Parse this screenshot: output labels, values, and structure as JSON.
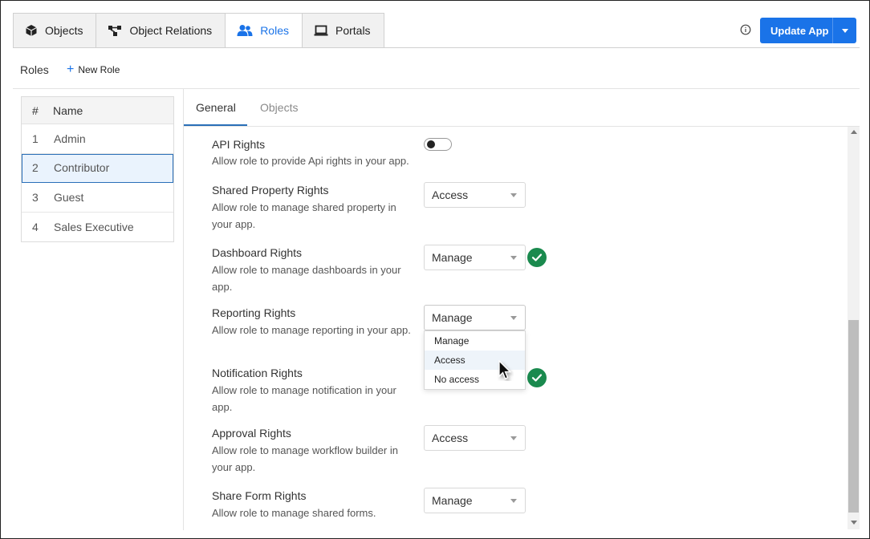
{
  "top_tabs": [
    {
      "label": "Objects",
      "icon": "cube-icon"
    },
    {
      "label": "Object Relations",
      "icon": "relations-icon"
    },
    {
      "label": "Roles",
      "icon": "users-icon",
      "active": true
    },
    {
      "label": "Portals",
      "icon": "laptop-icon"
    }
  ],
  "header": {
    "update_label": "Update App",
    "accent_color": "#1a73e8"
  },
  "subheader": {
    "title": "Roles",
    "new_role_label": "New Role"
  },
  "roles_table": {
    "col_num": "#",
    "col_name": "Name",
    "rows": [
      {
        "num": "1",
        "name": "Admin"
      },
      {
        "num": "2",
        "name": "Contributor",
        "selected": true
      },
      {
        "num": "3",
        "name": "Guest"
      },
      {
        "num": "4",
        "name": "Sales Executive"
      }
    ]
  },
  "content_tabs": {
    "general": "General",
    "objects": "Objects"
  },
  "rights": [
    {
      "title": "API Rights",
      "desc": "Allow role to provide Api rights in your app.",
      "control": "toggle",
      "toggle_on": false
    },
    {
      "title": "Shared Property Rights",
      "desc": "Allow role to manage shared property in your app.",
      "control": "select",
      "value": "Access"
    },
    {
      "title": "Dashboard Rights",
      "desc": "Allow role to manage dashboards in your app.",
      "control": "select",
      "value": "Manage",
      "saved": true
    },
    {
      "title": "Reporting Rights",
      "desc": "Allow role to manage reporting in your app.",
      "control": "select",
      "value": "Manage",
      "open": true
    },
    {
      "title": "Notification Rights",
      "desc": "Allow role to manage notification in your app.",
      "control": "select",
      "saved": true
    },
    {
      "title": "Approval Rights",
      "desc": "Allow role to manage workflow builder in your app.",
      "control": "select",
      "value": "Access"
    },
    {
      "title": "Share Form Rights",
      "desc": "Allow role to manage shared forms.",
      "control": "select",
      "value": "Manage"
    }
  ],
  "dropdown_options": [
    "Manage",
    "Access",
    "No access"
  ],
  "dropdown_hover": "Access",
  "status_color": "#1a8a4e"
}
